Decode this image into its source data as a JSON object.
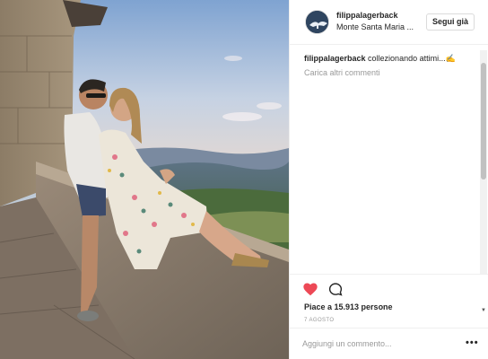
{
  "header": {
    "username": "filippalagerback",
    "location": "Monte Santa Maria ...",
    "follow_label": "Segui già"
  },
  "comments": {
    "caption_user": "filippalagerback",
    "caption_text": "collezionando attimi...",
    "caption_emoji": "✍",
    "load_more": "Carica altri commenti"
  },
  "actions": {
    "likes": "Piace a 15.913 persone",
    "date": "7 AGOSTO"
  },
  "add_comment": {
    "placeholder": "Aggiungi un commento...",
    "more": "•••"
  },
  "colors": {
    "like_heart": "#ed4956",
    "text": "#262626",
    "muted": "#999999",
    "border": "#efefef"
  },
  "icons": [
    "heart-icon",
    "comment-icon",
    "more-options-icon",
    "avatar-icon"
  ]
}
